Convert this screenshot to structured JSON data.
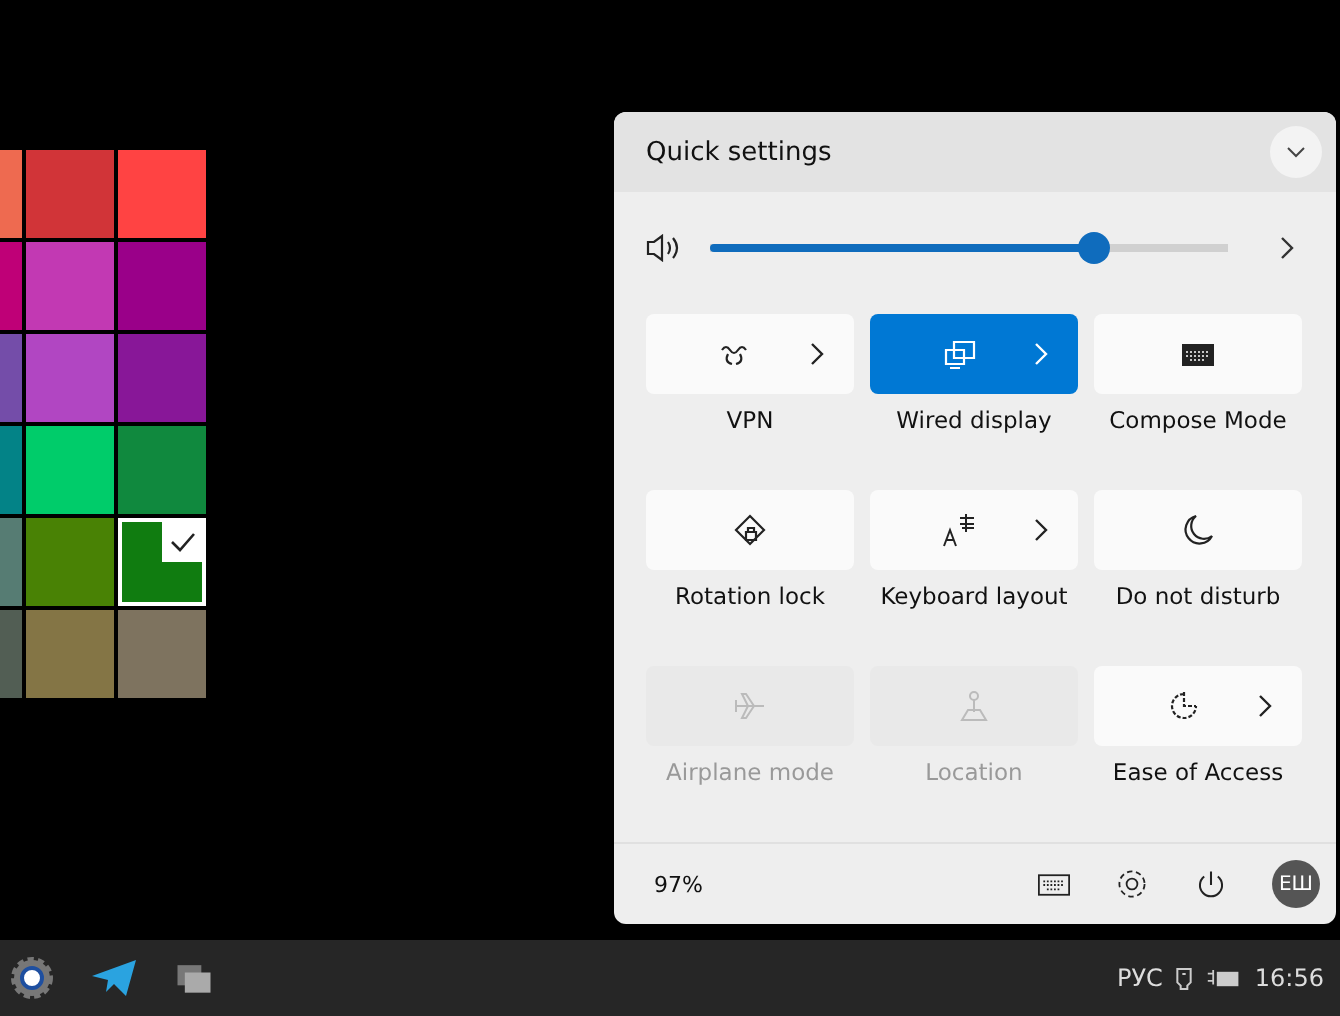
{
  "color_swatches": [
    [
      {
        "color": "#ee6a50",
        "selected": false
      },
      {
        "color": "#d13438",
        "selected": false
      },
      {
        "color": "#ff4343",
        "selected": false
      }
    ],
    [
      {
        "color": "#bf0077",
        "selected": false
      },
      {
        "color": "#c239b3",
        "selected": false
      },
      {
        "color": "#9a0089",
        "selected": false
      }
    ],
    [
      {
        "color": "#744da9",
        "selected": false
      },
      {
        "color": "#b146c2",
        "selected": false
      },
      {
        "color": "#881798",
        "selected": false
      }
    ],
    [
      {
        "color": "#038387",
        "selected": false
      },
      {
        "color": "#00cc6a",
        "selected": false
      },
      {
        "color": "#10893e",
        "selected": false
      }
    ],
    [
      {
        "color": "#567c73",
        "selected": false
      },
      {
        "color": "#498205",
        "selected": false
      },
      {
        "color": "#107c10",
        "selected": true
      }
    ],
    [
      {
        "color": "#525e54",
        "selected": false
      },
      {
        "color": "#847545",
        "selected": false
      },
      {
        "color": "#7e735f",
        "selected": false
      }
    ]
  ],
  "quick_settings": {
    "title": "Quick settings",
    "volume": {
      "level": 0.74
    },
    "tiles": [
      {
        "label": "VPN",
        "on": false,
        "disabled": false,
        "expandable": true
      },
      {
        "label": "Wired display",
        "on": true,
        "disabled": false,
        "expandable": true
      },
      {
        "label": "Compose Mode",
        "on": false,
        "disabled": false,
        "expandable": false
      },
      {
        "label": "Rotation lock",
        "on": false,
        "disabled": false,
        "expandable": false
      },
      {
        "label": "Keyboard layout",
        "on": false,
        "disabled": false,
        "expandable": true
      },
      {
        "label": "Do not disturb",
        "on": false,
        "disabled": false,
        "expandable": false
      },
      {
        "label": "Airplane mode",
        "on": false,
        "disabled": true,
        "expandable": false
      },
      {
        "label": "Location",
        "on": false,
        "disabled": true,
        "expandable": false
      },
      {
        "label": "Ease of Access",
        "on": false,
        "disabled": false,
        "expandable": true
      }
    ],
    "battery": "97%",
    "avatar": "ЕШ"
  },
  "taskbar": {
    "language": "РУС",
    "time": "16:56"
  }
}
